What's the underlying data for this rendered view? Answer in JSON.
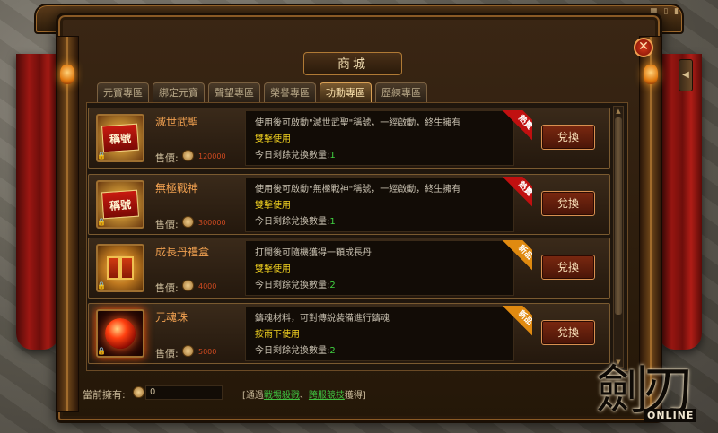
{
  "window": {
    "title": "商城",
    "close_glyph": "✕",
    "top_pips": "■ ▯ ▮"
  },
  "tabs": [
    {
      "label": "元寶專區",
      "active": false
    },
    {
      "label": "綁定元寶",
      "active": false
    },
    {
      "label": "聲望專區",
      "active": false
    },
    {
      "label": "榮譽專區",
      "active": false
    },
    {
      "label": "功勳專區",
      "active": true
    },
    {
      "label": "歷練專區",
      "active": false
    }
  ],
  "items": [
    {
      "name": "滅世武聖",
      "icon": "title-badge-icon",
      "icon_text": "稱號",
      "price_label": "售價:",
      "price": "120000",
      "desc": "使用後可啟動\"滅世武聖\"稱號，一經啟動，終生擁有",
      "usage": "雙擊使用",
      "remain_label": "今日剩餘兌換數量:",
      "remain": "1",
      "ribbon": "熱賣",
      "ribbon_type": "hot",
      "button": "兌換"
    },
    {
      "name": "無極戰神",
      "icon": "title-badge-icon",
      "icon_text": "稱號",
      "price_label": "售價:",
      "price": "300000",
      "desc": "使用後可啟動\"無極戰神\"稱號，一經啟動，終生擁有",
      "usage": "雙擊使用",
      "remain_label": "今日剩餘兌換數量:",
      "remain": "1",
      "ribbon": "熱賣",
      "ribbon_type": "hot",
      "button": "兌換"
    },
    {
      "name": "成長丹禮盒",
      "icon": "gift-box-icon",
      "icon_text": "",
      "price_label": "售價:",
      "price": "4000",
      "desc": "打開後可隨機獲得一顆成長丹",
      "usage": "雙擊使用",
      "remain_label": "今日剩餘兌換數量:",
      "remain": "2",
      "ribbon": "新品",
      "ribbon_type": "new",
      "button": "兌換"
    },
    {
      "name": "元魂珠",
      "icon": "red-orb-icon",
      "icon_text": "",
      "price_label": "售價:",
      "price": "5000",
      "desc": "鑄魂材料，可對傳說裝備進行鑄魂",
      "usage": "按雨下使用",
      "remain_label": "今日剩餘兌換數量:",
      "remain": "2",
      "ribbon": "新品",
      "ribbon_type": "new",
      "button": "兌換"
    }
  ],
  "footer": {
    "owned_label": "當前擁有:",
    "owned_value": "0",
    "note_prefix": "[通過",
    "link1": "戰場殺戮",
    "sep": "、",
    "link2": "跨服競技",
    "note_suffix": "獲得]"
  },
  "logo": {
    "main": "劍刃",
    "sub": "ONLINE"
  },
  "colors": {
    "accent_gold": "#d8a055",
    "hot_ribbon": "#c01010",
    "new_ribbon": "#e08a10",
    "count_green": "#40d040",
    "usage_yellow": "#f0d020"
  }
}
